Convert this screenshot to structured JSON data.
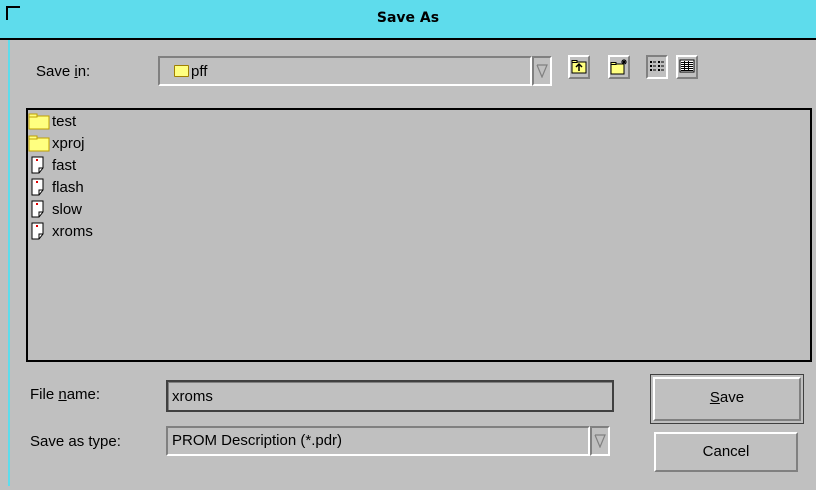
{
  "window": {
    "title": "Save As"
  },
  "save_in": {
    "label_pre": "Save ",
    "label_accel": "i",
    "label_post": "n:",
    "value": "pff",
    "icon": "folder-icon"
  },
  "toolbar": {
    "buttons": [
      {
        "name": "up-one-level",
        "icon": "folder-up-icon"
      },
      {
        "name": "create-new-folder",
        "icon": "new-folder-icon"
      },
      {
        "name": "list-view",
        "icon": "list-view-icon"
      },
      {
        "name": "details-view",
        "icon": "details-view-icon"
      }
    ]
  },
  "files": [
    {
      "name": "test",
      "type": "folder",
      "icon": "folder-icon"
    },
    {
      "name": "xproj",
      "type": "folder",
      "icon": "folder-icon"
    },
    {
      "name": "fast",
      "type": "file",
      "icon": "document-icon"
    },
    {
      "name": "flash",
      "type": "file",
      "icon": "document-icon"
    },
    {
      "name": "slow",
      "type": "file",
      "icon": "document-icon"
    },
    {
      "name": "xroms",
      "type": "file",
      "icon": "document-icon"
    }
  ],
  "file_name": {
    "label_pre": "File ",
    "label_accel": "n",
    "label_post": "ame:",
    "value": "xroms"
  },
  "save_as_type": {
    "label": "Save as type:",
    "value": "PROM Description (*.pdr)"
  },
  "buttons": {
    "save_accel": "S",
    "save_rest": "ave",
    "cancel": "Cancel"
  },
  "colors": {
    "titlebar": "#5edcec",
    "dialog_bg": "#c0c0c0",
    "folder": "#ffff80"
  }
}
